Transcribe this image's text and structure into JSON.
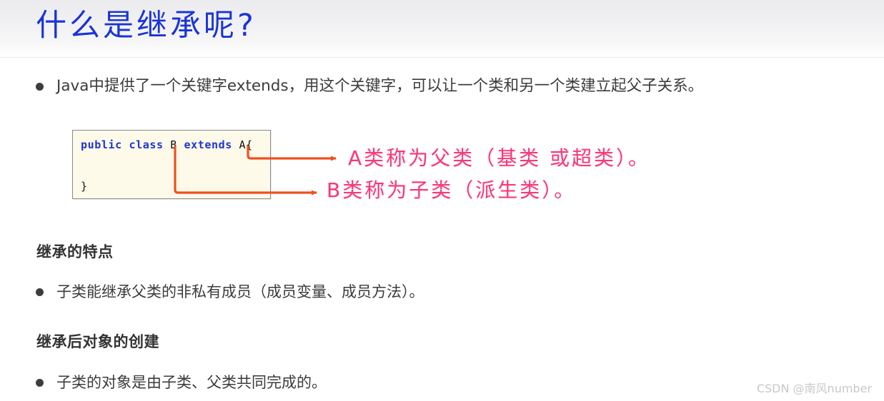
{
  "slide": {
    "title": "什么是继承呢?",
    "title_color": "#1b34d6",
    "background": "#ffffff"
  },
  "bullets": {
    "intro": "Java中提供了一个关键字extends，用这个关键字，可以让一个类和另一个类建立起父子关系。",
    "feature": "子类能继承父类的非私有成员（成员变量、成员方法）。",
    "creation": "子类的对象是由子类、父类共同完成的。"
  },
  "headings": {
    "features": "继承的特点",
    "creation": "继承后对象的创建"
  },
  "code_block": {
    "language": "java",
    "background": "#fdfaea",
    "border_color": "#8a8a8a",
    "keyword_color": "#1d36cf",
    "lines": [
      {
        "tokens": [
          {
            "text": "public",
            "type": "keyword"
          },
          {
            "text": " ",
            "type": "plain"
          },
          {
            "text": "class",
            "type": "keyword"
          },
          {
            "text": " B ",
            "type": "identifier"
          },
          {
            "text": "extends",
            "type": "keyword"
          },
          {
            "text": " A{",
            "type": "identifier"
          }
        ],
        "plain": "public class B extends A{"
      },
      {
        "tokens": [
          {
            "text": "}",
            "type": "identifier"
          }
        ],
        "plain": "}"
      }
    ],
    "line1_keyword_public": "public",
    "line1_keyword_class": "class",
    "line1_identifier_b": " B ",
    "line1_keyword_extends": "extends",
    "line1_identifier_a": " A{",
    "line2": "}"
  },
  "annotations": {
    "color": "#f8397c",
    "leader_color": "#f04f20",
    "parent": "A类称为父类（基类 或超类）。",
    "child": "B类称为子类（派生类）。"
  },
  "watermark": {
    "text": "CSDN @南风number",
    "color": "#c8c8cc"
  }
}
